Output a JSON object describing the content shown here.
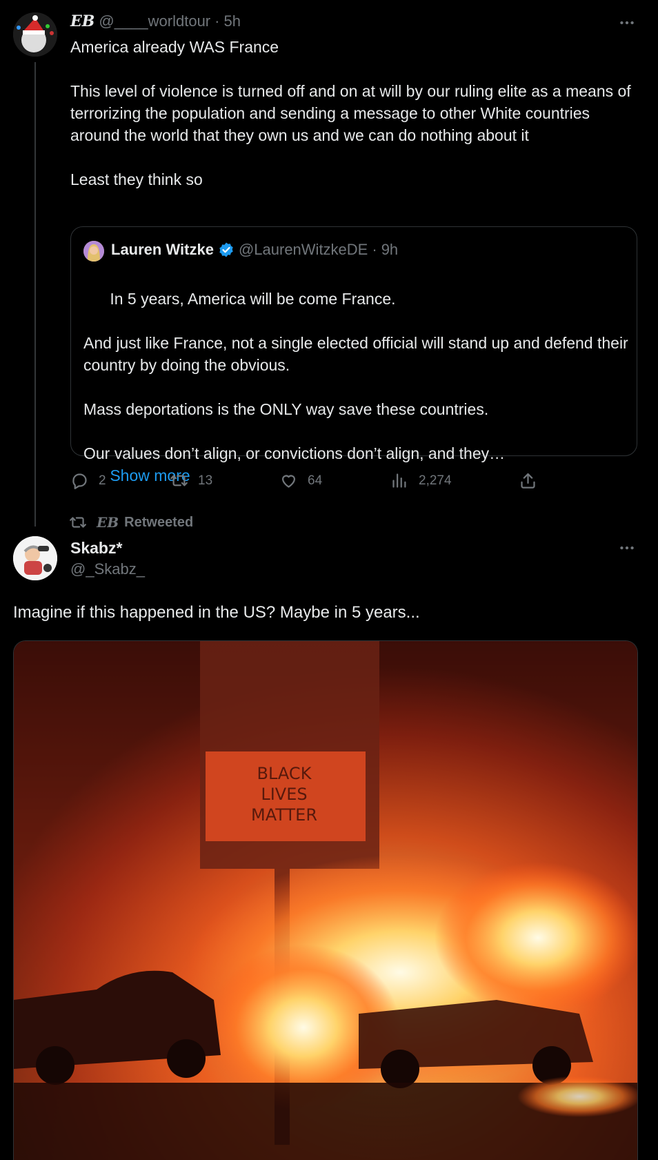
{
  "tweet1": {
    "name": "EB",
    "handle": "@____worldtour",
    "dot": "·",
    "time": "5h",
    "body": "America already WAS France\n\nThis level of violence is turned off and on at will by our ruling elite as a means of terrorizing the population and sending a message to other White countries around the world that they own us and we can do nothing about it\n\nLeast they think so",
    "quote": {
      "name": "Lauren Witzke",
      "handle": "@LaurenWitzkeDE",
      "dot": "·",
      "time": "9h",
      "body": "In 5 years, America will be come France.\n\nAnd just like France, not a single elected official will stand up and defend their country by doing the obvious.\n\nMass deportations is the ONLY way save these countries.\n\nOur values don’t align, or convictions don’t align, and they…",
      "show_more": "Show more"
    },
    "actions": {
      "replies": "2",
      "retweets": "13",
      "likes": "64",
      "views": "2,274"
    }
  },
  "retweet_banner": {
    "name": "EB",
    "label": "Retweeted"
  },
  "tweet2": {
    "name": "Skabz*",
    "handle": "@_Skabz_",
    "body": "Imagine if this happened in the US? Maybe in 5 years...",
    "media": {
      "sign_text": "BLACK\nLIVES\nMATTER"
    }
  },
  "colors": {
    "accent": "#1d9bf0",
    "muted": "#71767b",
    "border": "#2f3336",
    "background": "#000000"
  },
  "icons": [
    "more-icon",
    "reply-icon",
    "retweet-icon",
    "like-icon",
    "views-icon",
    "share-icon",
    "verified-badge-icon"
  ]
}
